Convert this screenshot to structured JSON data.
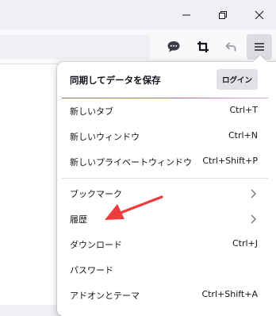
{
  "window": {
    "minimize_icon": "minimize-icon",
    "restore_icon": "restore-icon",
    "close_icon": "close-icon"
  },
  "toolbar": {
    "icons": [
      "speech-bubble-icon",
      "crop-icon",
      "back-arrow-icon",
      "hamburger-menu-icon"
    ]
  },
  "menu": {
    "sync_label": "同期してデータを保存",
    "login_label": "ログイン",
    "items": [
      {
        "label": "新しいタブ",
        "shortcut": "Ctrl+T"
      },
      {
        "label": "新しいウィンドウ",
        "shortcut": "Ctrl+N"
      },
      {
        "label": "新しいプライベートウィンドウ",
        "shortcut": "Ctrl+Shift+P"
      },
      {
        "label": "ブックマーク",
        "submenu": true
      },
      {
        "label": "履歴",
        "submenu": true
      },
      {
        "label": "ダウンロード",
        "shortcut": "Ctrl+J"
      },
      {
        "label": "パスワード",
        "shortcut": ""
      },
      {
        "label": "アドオンとテーマ",
        "shortcut": "Ctrl+Shift+A"
      }
    ]
  },
  "colors": {
    "annotation_arrow": "#ee3b3b",
    "sync_gradient_start": "#8b5cf6",
    "sync_gradient_end": "#e9a7e8"
  }
}
